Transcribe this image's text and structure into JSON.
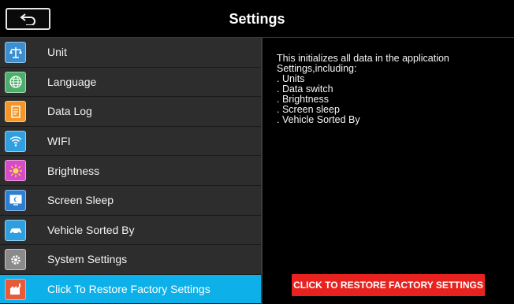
{
  "header": {
    "title": "Settings"
  },
  "sidebar": {
    "items": [
      {
        "label": "Unit",
        "icon": "scale-icon",
        "color": "#3b8fd0"
      },
      {
        "label": "Language",
        "icon": "globe-icon",
        "color": "#4cae6a"
      },
      {
        "label": "Data Log",
        "icon": "log-icon",
        "color": "#f0962a"
      },
      {
        "label": "WIFI",
        "icon": "wifi-icon",
        "color": "#2f9fe0"
      },
      {
        "label": "Brightness",
        "icon": "brightness-icon",
        "color": "#d64cc6"
      },
      {
        "label": "Screen Sleep",
        "icon": "screen-sleep-icon",
        "color": "#2f7fd0"
      },
      {
        "label": "Vehicle Sorted By",
        "icon": "car-icon",
        "color": "#2f9fe0"
      },
      {
        "label": "System Settings",
        "icon": "gear-icon",
        "color": "#8a8a8a"
      },
      {
        "label": "Click To Restore Factory Settings",
        "icon": "factory-icon",
        "color": "#e85a3a"
      }
    ],
    "active_index": 8
  },
  "content": {
    "description_lines": [
      "This initializes all data in the application",
      "Settings,including:",
      ". Units",
      ". Data switch",
      ". Brightness",
      ". Screen sleep",
      ". Vehicle Sorted By"
    ],
    "restore_button_label": "CLICK TO RESTORE FACTORY SETTINGS"
  },
  "colors": {
    "accent": "#0db0e8",
    "danger": "#e8231f"
  }
}
